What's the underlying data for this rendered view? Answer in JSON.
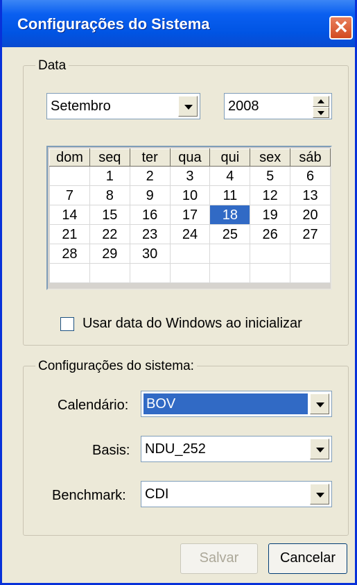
{
  "window": {
    "title": "Configurações do Sistema",
    "close_symbol": "✕"
  },
  "date_group": {
    "legend": "Data",
    "month": "Setembro",
    "year": "2008",
    "calendar": {
      "weekdays": [
        "dom",
        "seq",
        "ter",
        "qua",
        "qui",
        "sex",
        "sáb"
      ],
      "weeks": [
        [
          "",
          "1",
          "2",
          "3",
          "4",
          "5",
          "6"
        ],
        [
          "7",
          "8",
          "9",
          "10",
          "11",
          "12",
          "13"
        ],
        [
          "14",
          "15",
          "16",
          "17",
          "18",
          "19",
          "20"
        ],
        [
          "21",
          "22",
          "23",
          "24",
          "25",
          "26",
          "27"
        ],
        [
          "28",
          "29",
          "30",
          "",
          "",
          "",
          ""
        ],
        [
          "",
          "",
          "",
          "",
          "",
          "",
          ""
        ]
      ],
      "selected_day": "18"
    },
    "use_windows_date": {
      "label": "Usar data do Windows ao inicializar",
      "checked": false
    }
  },
  "system_group": {
    "legend": "Configurações do sistema:",
    "calendario": {
      "label": "Calendário:",
      "value": "BOV"
    },
    "basis": {
      "label": "Basis:",
      "value": "NDU_252"
    },
    "benchmark": {
      "label": "Benchmark:",
      "value": "CDI"
    }
  },
  "buttons": {
    "save": "Salvar",
    "cancel": "Cancelar",
    "save_enabled": false
  },
  "colors": {
    "title_bar": "#0054e3",
    "selection": "#316ac5",
    "window_bg": "#ece9d8"
  }
}
